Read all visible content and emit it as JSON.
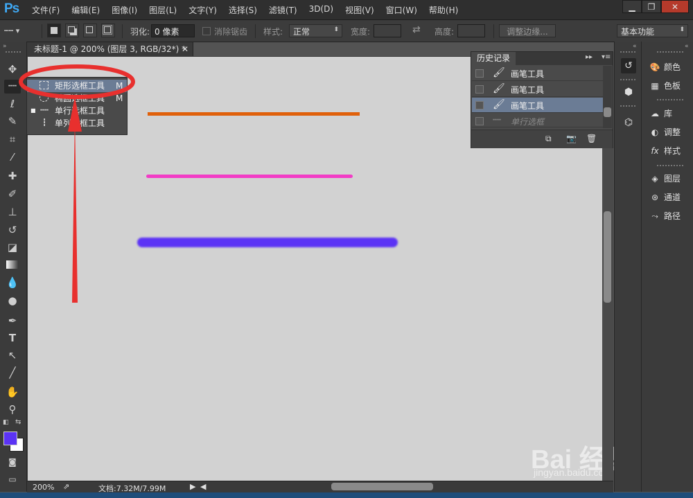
{
  "app": {
    "logo": "Ps"
  },
  "menu": [
    "文件(F)",
    "编辑(E)",
    "图像(I)",
    "图层(L)",
    "文字(Y)",
    "选择(S)",
    "滤镜(T)",
    "3D(D)",
    "视图(V)",
    "窗口(W)",
    "帮助(H)"
  ],
  "window_controls": {
    "minimize": "▁",
    "restore": "❐",
    "close": "✕"
  },
  "options": {
    "feather_label": "羽化:",
    "feather_value": "0 像素",
    "antialias_label": "消除锯齿",
    "style_label": "样式:",
    "style_value": "正常",
    "width_label": "宽度:",
    "height_label": "高度:",
    "refine_edge": "调整边缘...",
    "workspace": "基本功能"
  },
  "document": {
    "tab_title": "未标题-1 @ 200% (图层 3, RGB/32*) *",
    "zoom": "200%",
    "doc_info": "文档:7.32M/7.99M"
  },
  "flyout": {
    "items": [
      {
        "label": "矩形选框工具",
        "key": "M",
        "icon": "rect-marquee-icon",
        "active": false
      },
      {
        "label": "椭圆选框工具",
        "key": "M",
        "icon": "ellipse-marquee-icon",
        "active": false
      },
      {
        "label": "单行选框工具",
        "key": "",
        "icon": "single-row-marquee-icon",
        "active": true
      },
      {
        "label": "单列选框工具",
        "key": "",
        "icon": "single-column-marquee-icon",
        "active": false
      }
    ]
  },
  "history": {
    "title": "历史记录",
    "items": [
      {
        "label": "画笔工具",
        "icon": "brush-icon"
      },
      {
        "label": "画笔工具",
        "icon": "brush-icon"
      },
      {
        "label": "画笔工具",
        "icon": "brush-icon"
      },
      {
        "label": "单行选框",
        "icon": "single-row-marquee-icon"
      }
    ]
  },
  "panels": [
    {
      "label": "颜色",
      "icon": "palette-icon"
    },
    {
      "label": "色板",
      "icon": "swatches-icon"
    },
    {
      "label": "库",
      "icon": "library-icon"
    },
    {
      "label": "调整",
      "icon": "adjustment-icon"
    },
    {
      "label": "样式",
      "icon": "styles-icon"
    },
    {
      "label": "图层",
      "icon": "layers-icon"
    },
    {
      "label": "通道",
      "icon": "channels-icon"
    },
    {
      "label": "路径",
      "icon": "paths-icon"
    }
  ],
  "colors": {
    "orange_line": "#e0600a",
    "pink_line": "#f23cc6",
    "purple_line": "#5b33f5",
    "annotation_red": "#e8302e",
    "foreground": "#5b33f5",
    "background": "#ffffff"
  },
  "watermark": {
    "brand": "Bai 经验",
    "url": "jingyan.baidu.com"
  }
}
